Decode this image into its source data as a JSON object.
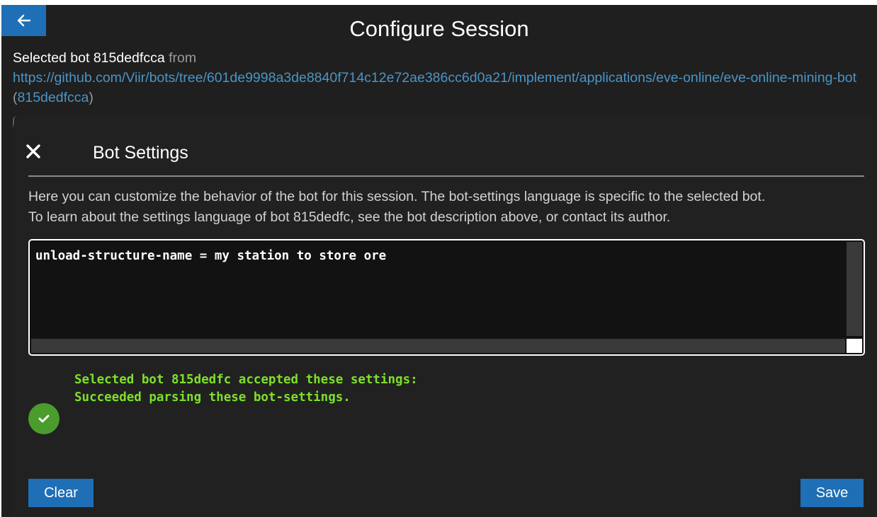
{
  "header": {
    "back_icon": "arrow-left-icon",
    "title": "Configure Session"
  },
  "bot_source": {
    "selected_label": "Selected bot 815dedfcca",
    "from_label": " from",
    "repo_url": "https://github.com/Viir/bots/tree/601de9998a3de8840f714c12e72ae386cc6d0a21/implement/applications/eve-online/eve-online-mining-bot",
    "open_paren": " (",
    "bot_id": "815dedfcca",
    "close_paren": ")"
  },
  "dialog": {
    "close_icon": "close-icon",
    "title": "Bot Settings",
    "description_line_1": "Here you can customize the behavior of the bot for this session. The bot-settings language is specific to the selected bot.",
    "description_line_2": "To learn about the settings language of bot 815dedfc, see the bot description above, or contact its author.",
    "settings_text": "unload-structure-name = my station to store ore",
    "status": {
      "icon": "check-circle-icon",
      "color": "#7ee02a",
      "line_1": "Selected bot 815dedfc accepted these settings:",
      "line_2": "Succeeded parsing these bot-settings."
    },
    "clear_label": "Clear",
    "save_label": "Save"
  },
  "colors": {
    "background": "#1f1f1f",
    "accent": "#1e6fb5",
    "link": "#4a95c6",
    "success_icon": "#4a9c2c"
  }
}
